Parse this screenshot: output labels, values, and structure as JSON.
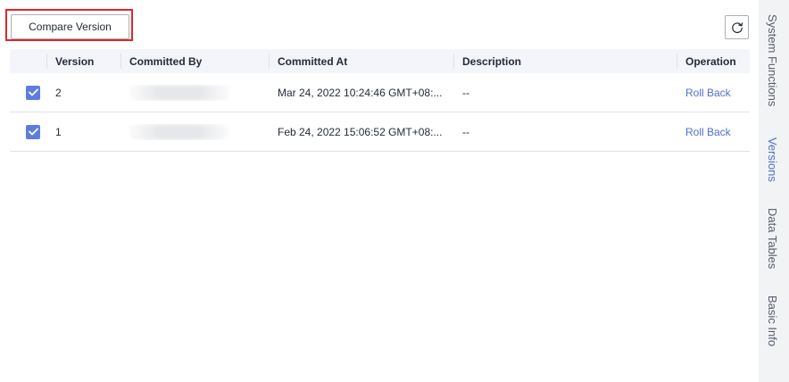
{
  "toolbar": {
    "compare_label": "Compare Version",
    "refresh_icon": "refresh-icon"
  },
  "table": {
    "columns": [
      "Version",
      "Committed By",
      "Committed At",
      "Description",
      "Operation"
    ],
    "rows": [
      {
        "checked": true,
        "version": "2",
        "committed_at": "Mar 24, 2022 10:24:46 GMT+08:...",
        "description": "--",
        "operation": "Roll Back"
      },
      {
        "checked": true,
        "version": "1",
        "committed_at": "Feb 24, 2022 15:06:52 GMT+08:...",
        "description": "--",
        "operation": "Roll Back"
      }
    ]
  },
  "side_tabs": [
    {
      "label": "System Functions",
      "active": false
    },
    {
      "label": "Versions",
      "active": true
    },
    {
      "label": "Data Tables",
      "active": false
    },
    {
      "label": "Basic Info",
      "active": false
    }
  ],
  "colors": {
    "accent": "#5e7ce0",
    "link": "#526ecc",
    "highlight_border": "#e0262a",
    "header_bg": "#f3f5fb",
    "side_bg": "#f2f3f5"
  }
}
